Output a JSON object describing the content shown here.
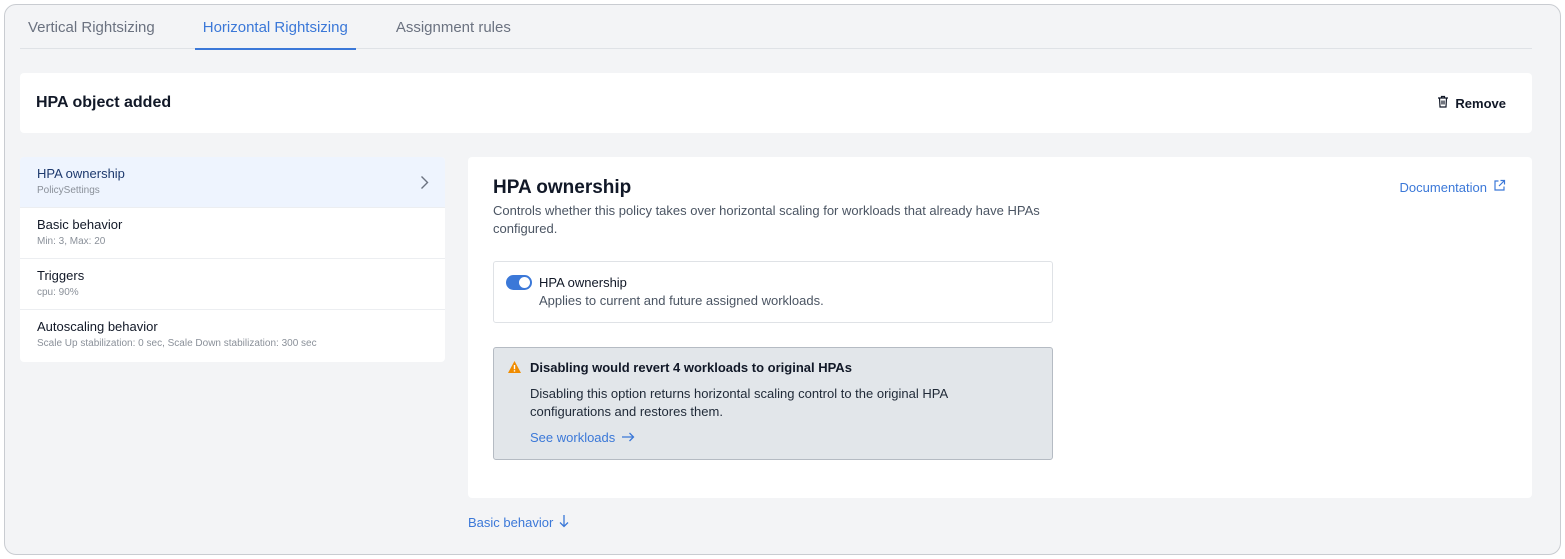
{
  "tabs": [
    {
      "label": "Vertical Rightsizing",
      "active": false
    },
    {
      "label": "Horizontal Rightsizing",
      "active": true
    },
    {
      "label": "Assignment rules",
      "active": false
    }
  ],
  "header": {
    "title": "HPA object added",
    "remove_label": "Remove",
    "remove_icon": "trash-icon"
  },
  "nav": {
    "items": [
      {
        "title": "HPA ownership",
        "subtitle": "PolicySettings",
        "selected": true
      },
      {
        "title": "Basic behavior",
        "subtitle": "Min: 3, Max: 20",
        "selected": false
      },
      {
        "title": "Triggers",
        "subtitle": "cpu: 90%",
        "selected": false
      },
      {
        "title": "Autoscaling behavior",
        "subtitle": "Scale Up stabilization: 0 sec, Scale Down stabilization: 300 sec",
        "selected": false
      }
    ]
  },
  "detail": {
    "title": "HPA ownership",
    "description": "Controls whether this policy takes over horizontal scaling for workloads that already have HPAs configured.",
    "doc_link": "Documentation",
    "toggle": {
      "label": "HPA ownership",
      "description": "Applies to current and future assigned workloads.",
      "enabled": true
    },
    "warning": {
      "title": "Disabling would revert 4 workloads to original HPAs",
      "text": "Disabling this option returns horizontal scaling control to the original HPA configurations and restores them.",
      "link": "See workloads"
    }
  },
  "next_section": {
    "label": "Basic behavior"
  },
  "colors": {
    "accent": "#3b78d8",
    "warning": "#f08c00",
    "selected_bg": "#eef4fe"
  }
}
